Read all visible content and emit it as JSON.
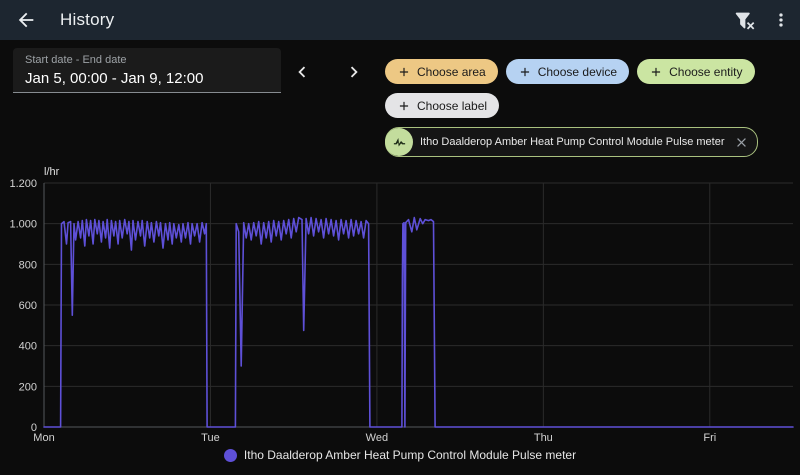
{
  "app_bar": {
    "title": "History",
    "back_icon": "arrow-left",
    "filter_icon": "filter-remove",
    "menu_icon": "dots-vertical",
    "background": "#1d2630"
  },
  "date_picker": {
    "label": "Start date - End date",
    "value": "Jan 5, 00:00 - Jan 9, 12:00"
  },
  "navigation": {
    "prev_icon": "chevron-left",
    "next_icon": "chevron-right"
  },
  "filter_chips": [
    {
      "label": "Choose area",
      "icon": "plus-icon",
      "bg": "#edc884"
    },
    {
      "label": "Choose device",
      "icon": "plus-icon",
      "bg": "#b6d2f2"
    },
    {
      "label": "Choose entity",
      "icon": "plus-icon",
      "bg": "#cbe5a2"
    },
    {
      "label": "Choose label",
      "icon": "plus-icon",
      "bg": "#e4e4e6"
    }
  ],
  "selected_entity_chip": {
    "label": "Itho Daalderop Amber Heat Pump Control Module Pulse meter",
    "avatar_icon": "pulse-icon",
    "close_icon": "close-icon",
    "border_color": "#a9c17f",
    "avatar_color": "#c3dd9d"
  },
  "chart_data": {
    "type": "line",
    "title": "",
    "unit": "l/hr",
    "ylabel": "l/hr",
    "xlabel": "",
    "grid": true,
    "legend_position": "bottom",
    "x_range_days": [
      0,
      4.5
    ],
    "x_ticks": [
      {
        "day": 0,
        "label": "Mon"
      },
      {
        "day": 1,
        "label": "Tue"
      },
      {
        "day": 2,
        "label": "Wed"
      },
      {
        "day": 3,
        "label": "Thu"
      },
      {
        "day": 4,
        "label": "Fri"
      }
    ],
    "y_range": [
      0,
      1200
    ],
    "y_ticks": [
      {
        "value": 0,
        "label": "0"
      },
      {
        "value": 200,
        "label": "200"
      },
      {
        "value": 400,
        "label": "400"
      },
      {
        "value": 600,
        "label": "600"
      },
      {
        "value": 800,
        "label": "800"
      },
      {
        "value": 1000,
        "label": "1.000"
      },
      {
        "value": 1200,
        "label": "1.200"
      }
    ],
    "colors": {
      "grid": "#2b2b2b",
      "axis": "#55585c",
      "tick_text": "#d2d2d2",
      "unit_text": "#e0e0e0"
    },
    "series": [
      {
        "name": "Itho Daalderop Amber Heat Pump Control Module Pulse meter",
        "color": "#5e50d8",
        "points_day_lhr": [
          [
            0,
            0
          ],
          [
            0.1,
            0
          ],
          [
            0.105,
            1000
          ],
          [
            0.12,
            1010
          ],
          [
            0.135,
            900
          ],
          [
            0.145,
            1005
          ],
          [
            0.16,
            1010
          ],
          [
            0.17,
            550
          ],
          [
            0.18,
            1000
          ],
          [
            0.19,
            920
          ],
          [
            0.205,
            1010
          ],
          [
            0.22,
            930
          ],
          [
            0.23,
            1015
          ],
          [
            0.245,
            890
          ],
          [
            0.255,
            1020
          ],
          [
            0.27,
            940
          ],
          [
            0.28,
            1015
          ],
          [
            0.295,
            900
          ],
          [
            0.305,
            1020
          ],
          [
            0.32,
            950
          ],
          [
            0.33,
            1015
          ],
          [
            0.345,
            910
          ],
          [
            0.355,
            1010
          ],
          [
            0.37,
            930
          ],
          [
            0.38,
            1020
          ],
          [
            0.395,
            880
          ],
          [
            0.405,
            1015
          ],
          [
            0.42,
            940
          ],
          [
            0.43,
            1010
          ],
          [
            0.445,
            900
          ],
          [
            0.455,
            1015
          ],
          [
            0.47,
            930
          ],
          [
            0.485,
            1020
          ],
          [
            0.5,
            950
          ],
          [
            0.51,
            1010
          ],
          [
            0.525,
            870
          ],
          [
            0.535,
            1015
          ],
          [
            0.55,
            920
          ],
          [
            0.565,
            1010
          ],
          [
            0.58,
            940
          ],
          [
            0.59,
            1015
          ],
          [
            0.605,
            890
          ],
          [
            0.62,
            1010
          ],
          [
            0.635,
            930
          ],
          [
            0.645,
            1005
          ],
          [
            0.66,
            910
          ],
          [
            0.675,
            1010
          ],
          [
            0.69,
            940
          ],
          [
            0.7,
            1005
          ],
          [
            0.715,
            880
          ],
          [
            0.73,
            1000
          ],
          [
            0.745,
            920
          ],
          [
            0.755,
            1005
          ],
          [
            0.77,
            900
          ],
          [
            0.78,
            1000
          ],
          [
            0.795,
            930
          ],
          [
            0.81,
            995
          ],
          [
            0.825,
            910
          ],
          [
            0.835,
            1000
          ],
          [
            0.85,
            930
          ],
          [
            0.865,
            1005
          ],
          [
            0.88,
            900
          ],
          [
            0.89,
            1000
          ],
          [
            0.905,
            940
          ],
          [
            0.92,
            1000
          ],
          [
            0.935,
            910
          ],
          [
            0.95,
            1005
          ],
          [
            0.965,
            950
          ],
          [
            0.975,
            1000
          ],
          [
            0.98,
            0
          ],
          [
            1.15,
            0
          ],
          [
            1.155,
            1000
          ],
          [
            1.17,
            960
          ],
          [
            1.185,
            300
          ],
          [
            1.2,
            1005
          ],
          [
            1.215,
            930
          ],
          [
            1.23,
            1000
          ],
          [
            1.245,
            920
          ],
          [
            1.26,
            1005
          ],
          [
            1.275,
            940
          ],
          [
            1.29,
            1010
          ],
          [
            1.305,
            900
          ],
          [
            1.32,
            1005
          ],
          [
            1.335,
            930
          ],
          [
            1.35,
            1010
          ],
          [
            1.365,
            910
          ],
          [
            1.38,
            1015
          ],
          [
            1.395,
            940
          ],
          [
            1.41,
            1010
          ],
          [
            1.425,
            920
          ],
          [
            1.44,
            1015
          ],
          [
            1.455,
            950
          ],
          [
            1.47,
            1020
          ],
          [
            1.485,
            930
          ],
          [
            1.5,
            1025
          ],
          [
            1.515,
            960
          ],
          [
            1.53,
            1030
          ],
          [
            1.55,
            1020
          ],
          [
            1.56,
            475
          ],
          [
            1.575,
            1025
          ],
          [
            1.59,
            950
          ],
          [
            1.605,
            1030
          ],
          [
            1.62,
            940
          ],
          [
            1.635,
            1025
          ],
          [
            1.65,
            960
          ],
          [
            1.665,
            1020
          ],
          [
            1.68,
            930
          ],
          [
            1.695,
            1025
          ],
          [
            1.71,
            950
          ],
          [
            1.725,
            1020
          ],
          [
            1.74,
            940
          ],
          [
            1.755,
            1015
          ],
          [
            1.77,
            920
          ],
          [
            1.785,
            1020
          ],
          [
            1.8,
            950
          ],
          [
            1.815,
            1015
          ],
          [
            1.83,
            930
          ],
          [
            1.845,
            1020
          ],
          [
            1.86,
            940
          ],
          [
            1.875,
            1015
          ],
          [
            1.89,
            950
          ],
          [
            1.905,
            1010
          ],
          [
            1.92,
            930
          ],
          [
            1.935,
            1015
          ],
          [
            1.95,
            1000
          ],
          [
            1.958,
            0
          ],
          [
            2.15,
            0
          ],
          [
            2.153,
            730
          ],
          [
            2.156,
            1000
          ],
          [
            2.163,
            1005
          ],
          [
            2.168,
            0
          ],
          [
            2.173,
            1005
          ],
          [
            2.19,
            1020
          ],
          [
            2.21,
            960
          ],
          [
            2.225,
            1030
          ],
          [
            2.24,
            970
          ],
          [
            2.26,
            1025
          ],
          [
            2.275,
            1000
          ],
          [
            2.29,
            1020
          ],
          [
            2.31,
            1015
          ],
          [
            2.325,
            1020
          ],
          [
            2.34,
            1010
          ],
          [
            2.35,
            0
          ],
          [
            4.5,
            0
          ]
        ]
      }
    ]
  },
  "legend": {
    "label": "Itho Daalderop Amber Heat Pump Control Module Pulse meter"
  }
}
